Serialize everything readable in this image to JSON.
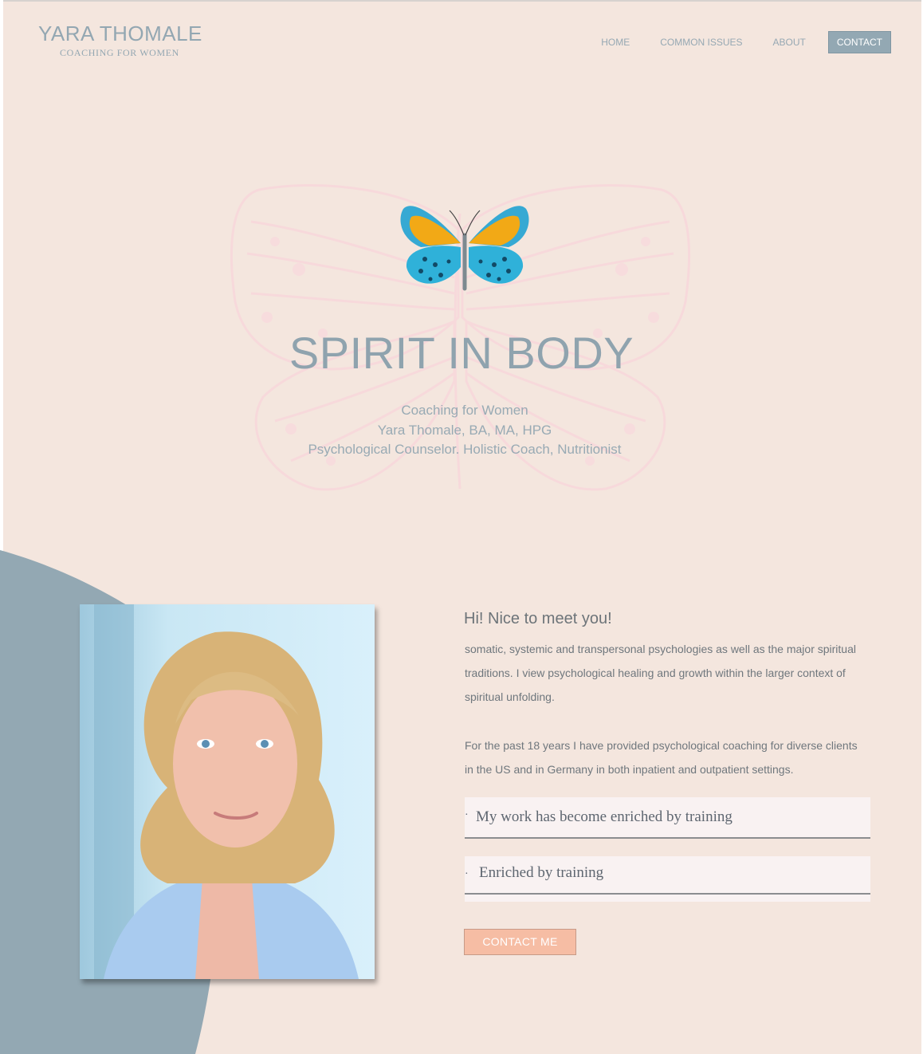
{
  "brand": {
    "name": "YARA THOMALE",
    "tagline": "COACHING FOR WOMEN"
  },
  "nav": {
    "items": [
      "HOME",
      "COMMON ISSUES",
      "ABOUT",
      "CONTACT"
    ],
    "active": "CONTACT"
  },
  "hero": {
    "title": "SPIRIT IN BODY",
    "subtitle_lines": [
      "Coaching for Women",
      "Yara Thomale, BA, MA, HPG",
      "Psychological Counselor. Holistic Coach, Nutritionist"
    ]
  },
  "intro": {
    "heading": "Hi! Nice to meet you!",
    "paragraph1": "somatic, systemic and transpersonal psychologies as well as the major spiritual traditions. I view psychological healing and growth within the larger context of spiritual unfolding.",
    "paragraph2": "For the past 18 years I have provided psychological coaching for diverse clients in the US and in Germany in both inpatient and outpatient settings.",
    "bullets": [
      "My work has become enriched by training",
      "Enriched by training"
    ],
    "cta_label": "CONTACT ME"
  },
  "colors": {
    "page_bg": "#f4e6de",
    "accent_blue": "#93a8b3",
    "cta_peach": "#f6bda4",
    "text_gray": "#6f777d"
  },
  "icons": [
    "butterfly-illustration",
    "butterfly-watermark"
  ]
}
